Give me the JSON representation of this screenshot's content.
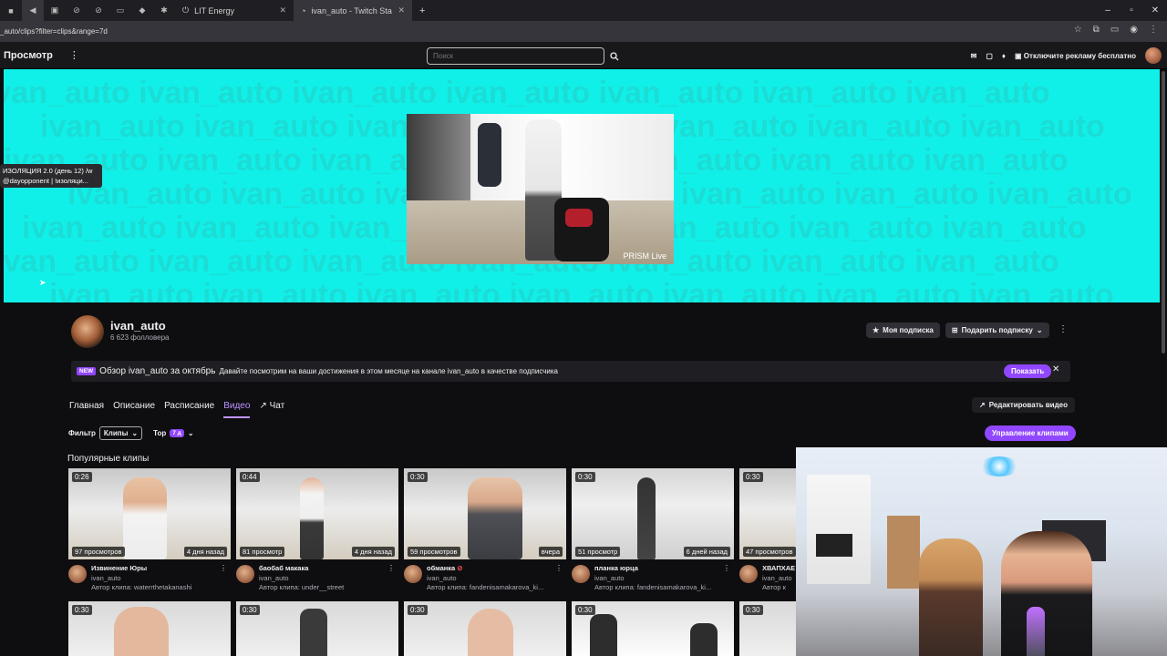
{
  "browser": {
    "tabs": [
      {
        "label": "LIT Energy"
      },
      {
        "label": "ivan_auto - Twitch Stats, Analyt"
      }
    ],
    "url": "_auto/clips?filter=clips&range=7d"
  },
  "topnav": {
    "browse": "Просмотр",
    "search_placeholder": "Поиск",
    "ad_free": "Отключите рекламу бесплатно"
  },
  "banner": {
    "pattern_text": "ivan_auto ivan_auto ivan_auto ivan_auto ivan_auto ivan_auto ivan_auto",
    "prism_label": "PRISM Live",
    "tooltip_line1": "ИЗОЛЯЦИЯ 2.0 (день 12) /w",
    "tooltip_line2": "@dayopponent | !изоляци..."
  },
  "channel": {
    "name": "ivan_auto",
    "followers": "6 623 фолловера",
    "subscribe_label": "Моя подписка",
    "gift_label": "Подарить подписку",
    "promo": {
      "badge": "NEW",
      "title": "Обзор ivan_auto за октябрь",
      "text": "Давайте посмотрим на ваши достижения в этом месяце на канале ivan_auto в качестве подписчика",
      "show": "Показать"
    },
    "nav": [
      "Главная",
      "Описание",
      "Расписание",
      "Видео",
      "Чат"
    ],
    "edit_video": "Редактировать видео",
    "manage_clips": "Управление клипами",
    "filter_label": "Фильтр",
    "filter_value": "Клипы",
    "top_label": "Тор",
    "range_value": "7 д",
    "section_title": "Популярные клипы"
  },
  "clips": [
    {
      "duration": "0:26",
      "views": "97 просмотров",
      "ago": "4 дня назад",
      "title": "Извинение Юры",
      "channel": "ivan_auto",
      "author": "Автор клипа: waterrthetakanashi"
    },
    {
      "duration": "0:44",
      "views": "81 просмотр",
      "ago": "4 дня назад",
      "title": "баобаб макака",
      "channel": "ivan_auto",
      "author": "Автор клипа: under__street"
    },
    {
      "duration": "0:30",
      "views": "59 просмотров",
      "ago": "вчера",
      "title": "обманка",
      "channel": "ivan_auto",
      "author": "Автор клипа: fandenisamakarova_ki..."
    },
    {
      "duration": "0:30",
      "views": "51 просмотр",
      "ago": "6 дней назад",
      "title": "планка юрца",
      "channel": "ivan_auto",
      "author": "Автор клипа: fandenisamakarova_ki..."
    },
    {
      "duration": "0:30",
      "views": "47 просмотров",
      "ago": "",
      "title": "ХВАПХАЕ",
      "channel": "ivan_auto",
      "author": "Автор к"
    }
  ],
  "clips_row2": [
    {
      "duration": "0:30"
    },
    {
      "duration": "0:30"
    },
    {
      "duration": "0:30"
    },
    {
      "duration": "0:30"
    },
    {
      "duration": "0:30"
    }
  ]
}
